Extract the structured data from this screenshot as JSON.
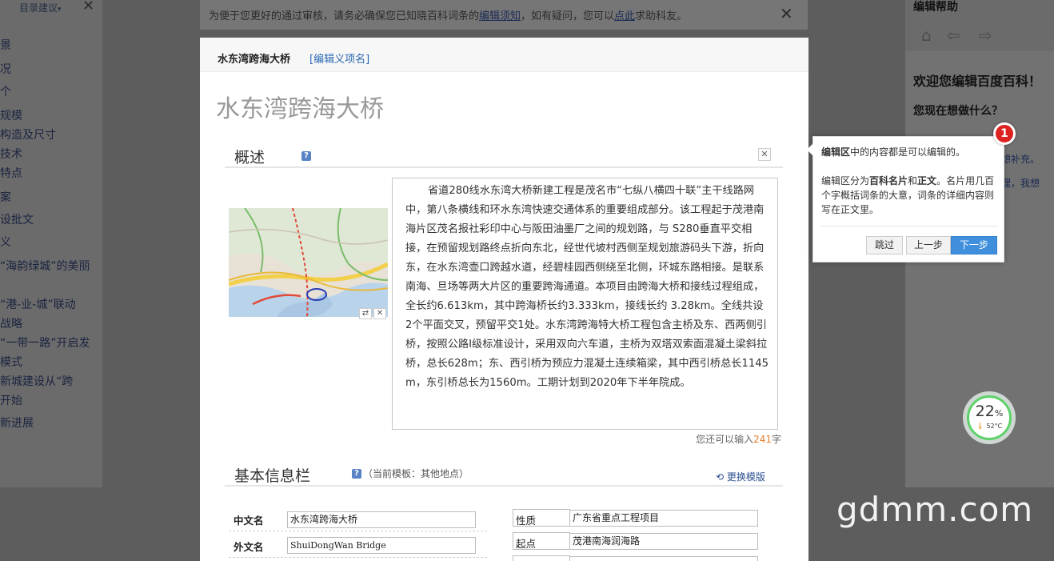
{
  "bg": {
    "toc_label": "目录建议",
    "toc_items": [
      "景",
      "况",
      "个",
      "规模",
      "构造及尺寸",
      "技术",
      "特点",
      "案",
      "设批文",
      "义",
      "“海韵绿城”的美丽",
      "“港-业-城”联动",
      "战略",
      "“一带一路”开启发",
      "模式",
      "新城建设从“跨",
      "开始",
      "新进展"
    ],
    "notice_prefix": "为便于您更好的通过审核，请务必确保您已知晓百科词条的",
    "notice_link1": "编辑须知",
    "notice_mid": "，如有疑问，您可以",
    "notice_link2": "点此",
    "notice_suffix": "求助科友。",
    "help_title": "编辑帮助",
    "welcome": "欢迎您编辑百度百科！",
    "question": "您现在想做什么？",
    "options": [
      "更正。",
      "我想补充。",
      "合理，我想"
    ]
  },
  "modal": {
    "entry_name": "水东湾跨海大桥",
    "edit_link": "[编辑义项名]",
    "big_title": "水东湾跨海大桥",
    "summary_heading": "概述",
    "help_icon": "?",
    "summary_text": "省道280线水东湾大桥新建工程是茂名市“七纵八横四十联”主干线路网中，第八条横线和环水东湾快速交通体系的重要组成部分。该工程起于茂港南海片区茂名报社彩印中心与阪田油墨厂之间的规划路，与 S280垂直平交相接，在预留规划路终点折向东北，经世代坡村西侧至规划旅游码头下游，折向东，在水东湾壶口跨越水道，经碧桂园西侧绕至北侧，环城东路相接。是联系南海、旦场等两大片区的重要跨海通道。本项目由跨海大桥和接线过程组成，全长约6.613km，其中跨海桥长约3.333km，接线长约 3.28km。全线共设2个平面交叉，预留平交1处。水东湾跨海特大桥工程包含主桥及东、西两侧引桥，按照公路Ⅰ级标准设计，采用双向六车道，主桥为双塔双索面混凝土梁斜拉桥，总长628m；东、西引桥为预应力混凝土连续箱梁，其中西引桥总长1145m，东引桥总长为1560m。工期计划到2020年下半年院成。",
    "count_prefix": "您还可以输入",
    "count_value": "241",
    "count_suffix": "字",
    "infobox_heading": "基本信息栏",
    "template_note": "（当前模板：其他地点）",
    "change_template": "更换模版",
    "fields_left": [
      {
        "label": "中文名",
        "value": "水东湾跨海大桥"
      },
      {
        "label": "外文名",
        "value": "ShuiDongWan Bridge"
      }
    ],
    "fields_right": [
      {
        "label": "性质",
        "value": "广东省重点工程项目"
      },
      {
        "label": "起点",
        "value": "茂港南海润海路"
      }
    ]
  },
  "tooltip": {
    "step": "1",
    "p1_bold": "编辑区",
    "p1_rest": "中的内容都是可以编辑的。",
    "p2_a": "编辑区分为",
    "p2_b": "百科名片",
    "p2_c": "和",
    "p2_d": "正文",
    "p2_e": "。名片用几百个字概括词条的大意，词条的详细内容则写在正文里。",
    "skip": "跳过",
    "prev": "上一步",
    "next": "下一步"
  },
  "cpu": {
    "percent": "22",
    "unit": "%",
    "temp": "52°C"
  },
  "watermark": "gdmm.com"
}
